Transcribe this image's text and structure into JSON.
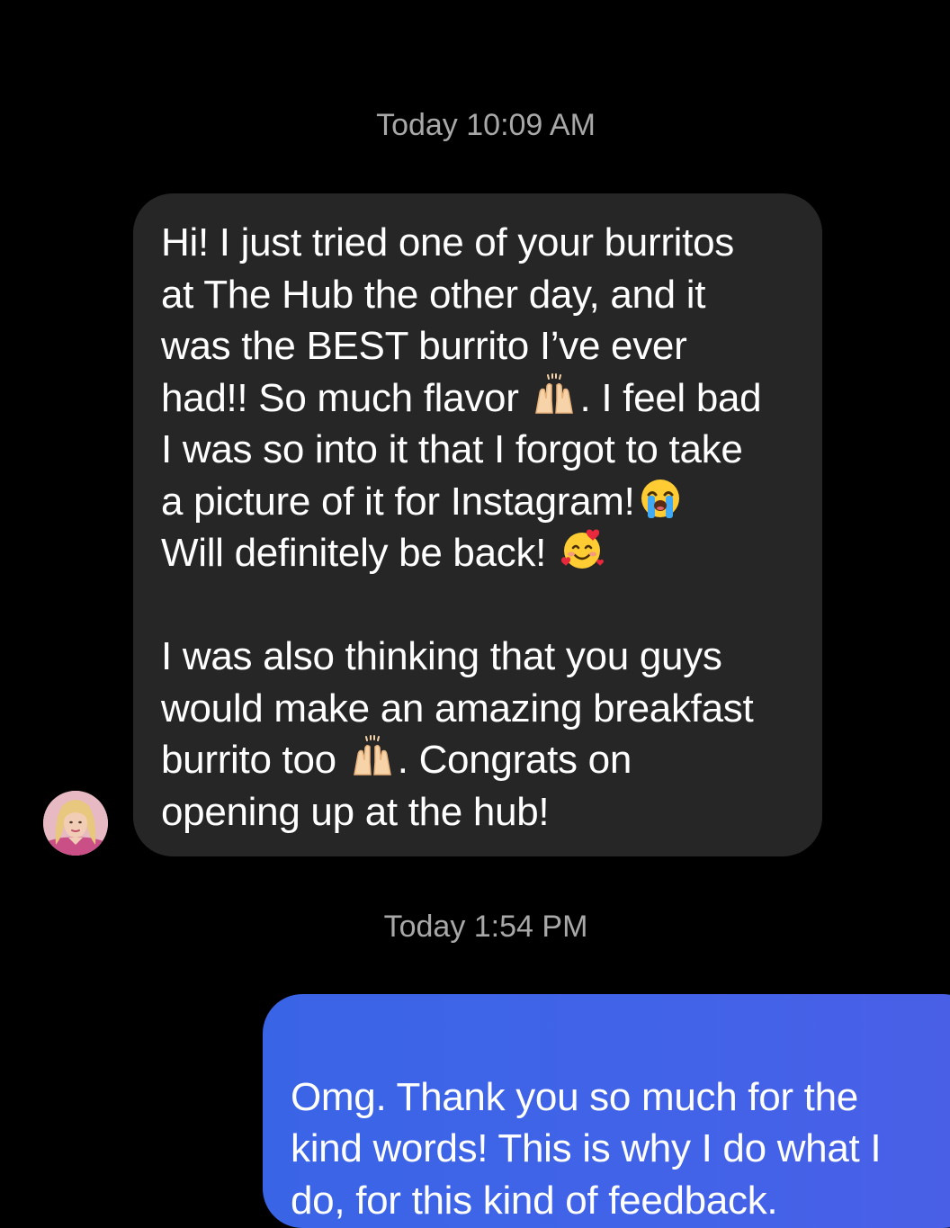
{
  "thread": {
    "timestamp_1": "Today 10:09 AM",
    "timestamp_2": "Today 1:54 PM"
  },
  "incoming_message": {
    "para1": {
      "t1": "Hi! I just tried one of your burritos\nat The Hub the other day, and it\nwas the BEST burrito I’ve ever\nhad!! So much flavor ",
      "t2": ". I feel bad\nI was so into it that I forgot to take\na picture of it for Instagram!",
      "t3": "\nWill definitely be back! "
    },
    "para2": {
      "t1": "I was also thinking that you guys\nwould make an amazing breakfast\nburrito too ",
      "t2": ". Congrats on\nopening up at the hub!"
    },
    "emojis": [
      "raising-hands-emoji",
      "loudly-crying-face-emoji",
      "smiling-face-with-hearts-emoji",
      "raising-hands-emoji"
    ]
  },
  "outgoing_message": {
    "text": "Omg. Thank you so much for the\nkind words! This is why I do what I\ndo, for this kind of feedback."
  },
  "colors": {
    "background": "#000000",
    "incoming_bubble": "#262626",
    "outgoing_bubble": "#3f63e7",
    "timestamp_text": "#a8a8a8",
    "message_text": "#ffffff"
  }
}
